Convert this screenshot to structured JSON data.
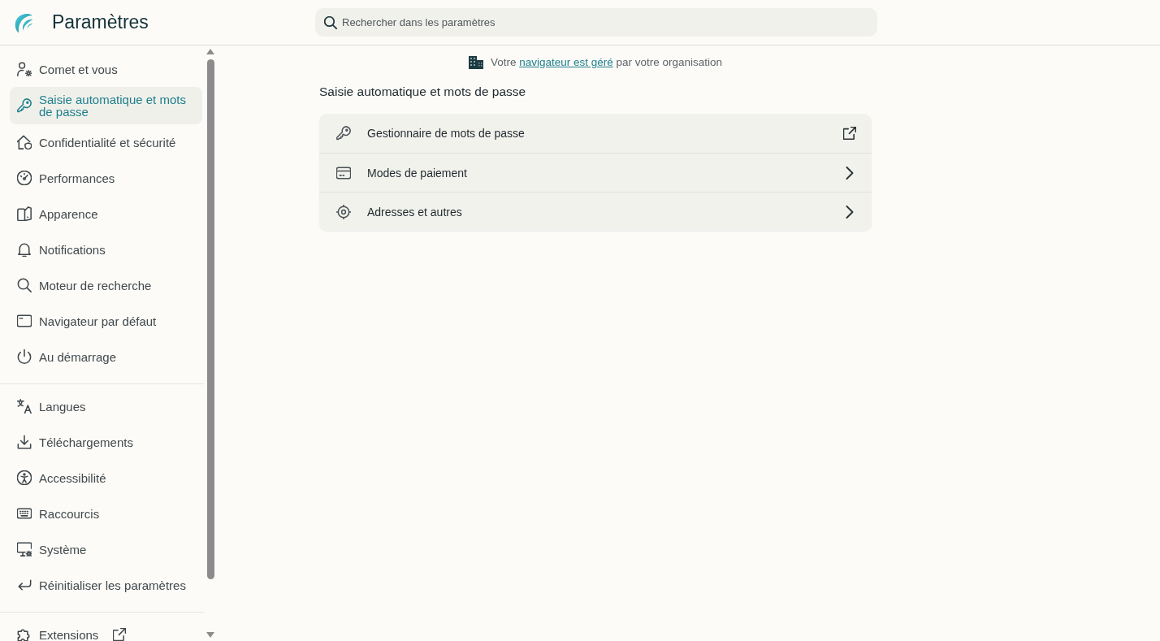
{
  "header": {
    "title": "Paramètres",
    "search": {
      "placeholder": "Rechercher dans les paramètres"
    }
  },
  "sidebar": {
    "groups": [
      {
        "items": [
          {
            "label": "Comet et vous",
            "kind": "page",
            "selected": false
          },
          {
            "label": "Saisie automatique et mots de passe",
            "kind": "page",
            "selected": true
          },
          {
            "label": "Confidentialité et sécurité",
            "kind": "page",
            "selected": false
          },
          {
            "label": "Performances",
            "kind": "page",
            "selected": false
          },
          {
            "label": "Apparence",
            "kind": "page",
            "selected": false
          },
          {
            "label": "Notifications",
            "kind": "page",
            "selected": false
          },
          {
            "label": "Moteur de recherche",
            "kind": "page",
            "selected": false
          },
          {
            "label": "Navigateur par défaut",
            "kind": "page",
            "selected": false
          },
          {
            "label": "Au démarrage",
            "kind": "page",
            "selected": false
          }
        ]
      },
      {
        "items": [
          {
            "label": "Langues",
            "kind": "page",
            "selected": false
          },
          {
            "label": "Téléchargements",
            "kind": "page",
            "selected": false
          },
          {
            "label": "Accessibilité",
            "kind": "page",
            "selected": false
          },
          {
            "label": "Raccourcis",
            "kind": "page",
            "selected": false
          },
          {
            "label": "Système",
            "kind": "page",
            "selected": false
          },
          {
            "label": "Réinitialiser les paramètres",
            "kind": "page",
            "selected": false
          }
        ]
      },
      {
        "items": [
          {
            "label": "Extensions",
            "kind": "external",
            "selected": false
          }
        ]
      }
    ]
  },
  "notice": {
    "before": "Votre",
    "link": "navigateur est géré",
    "after": "par votre organisation"
  },
  "section": {
    "title": "Saisie automatique et mots de passe",
    "rows": [
      {
        "label": "Gestionnaire de mots de passe",
        "kind": "external"
      },
      {
        "label": "Modes de paiement",
        "kind": "page"
      },
      {
        "label": "Adresses et autres",
        "kind": "page"
      }
    ]
  }
}
